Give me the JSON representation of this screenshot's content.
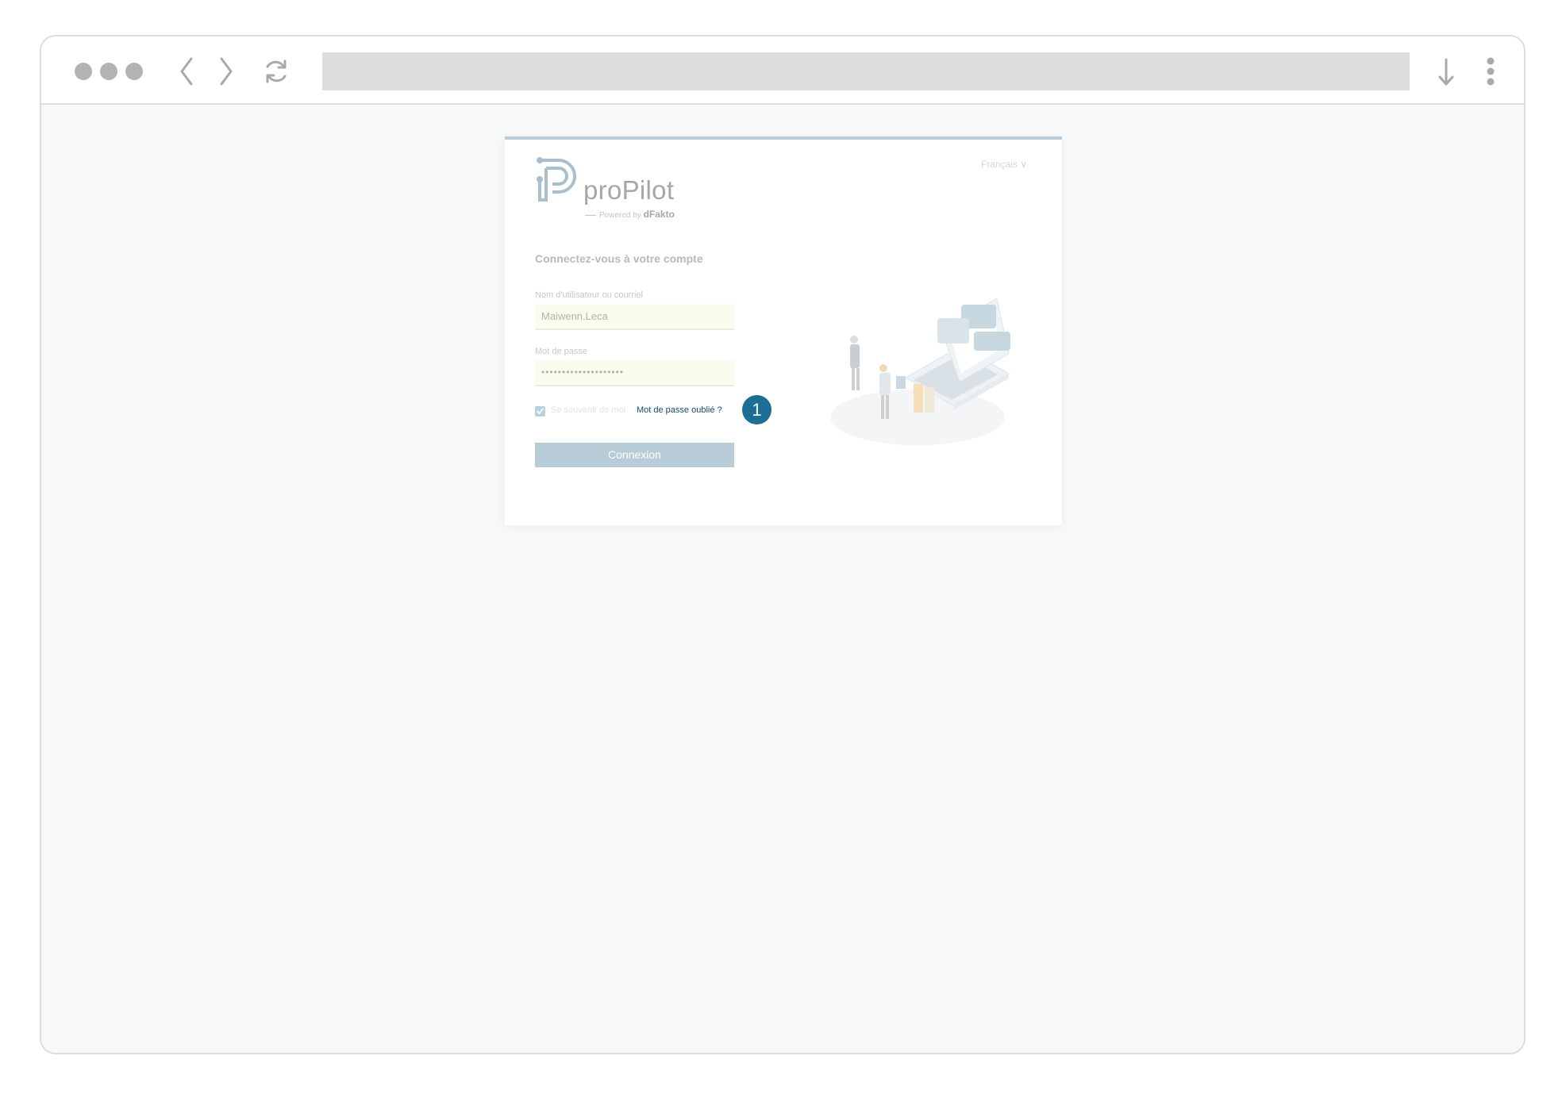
{
  "browser": {
    "address_value": "",
    "icons": [
      "window-dots-icon",
      "back-arrow-icon",
      "forward-arrow-icon",
      "reload-icon",
      "download-icon",
      "menu-kebab-icon"
    ]
  },
  "login": {
    "language_label": "Français ∨",
    "brand_name": "proPilot",
    "powered_by_prefix": "Powered by",
    "powered_by_brand": "dFakto",
    "heading": "Connectez-vous à votre compte",
    "username_label": "Nom d'utilisateur ou courriel",
    "username_value": "Maiwenn.Leca",
    "password_label": "Mot de passe",
    "password_value": "••••••••••••••••••••",
    "remember_label": "Se souvenir de moi",
    "remember_checked": true,
    "forgot_link": "Mot de passe oublié ?",
    "submit_label": "Connexion",
    "annotation_number": "1"
  },
  "colors": {
    "accent": "#b8ccd7",
    "link": "#154c6a",
    "badge": "#1c6e94",
    "autofill_bg": "#fbfbee"
  }
}
